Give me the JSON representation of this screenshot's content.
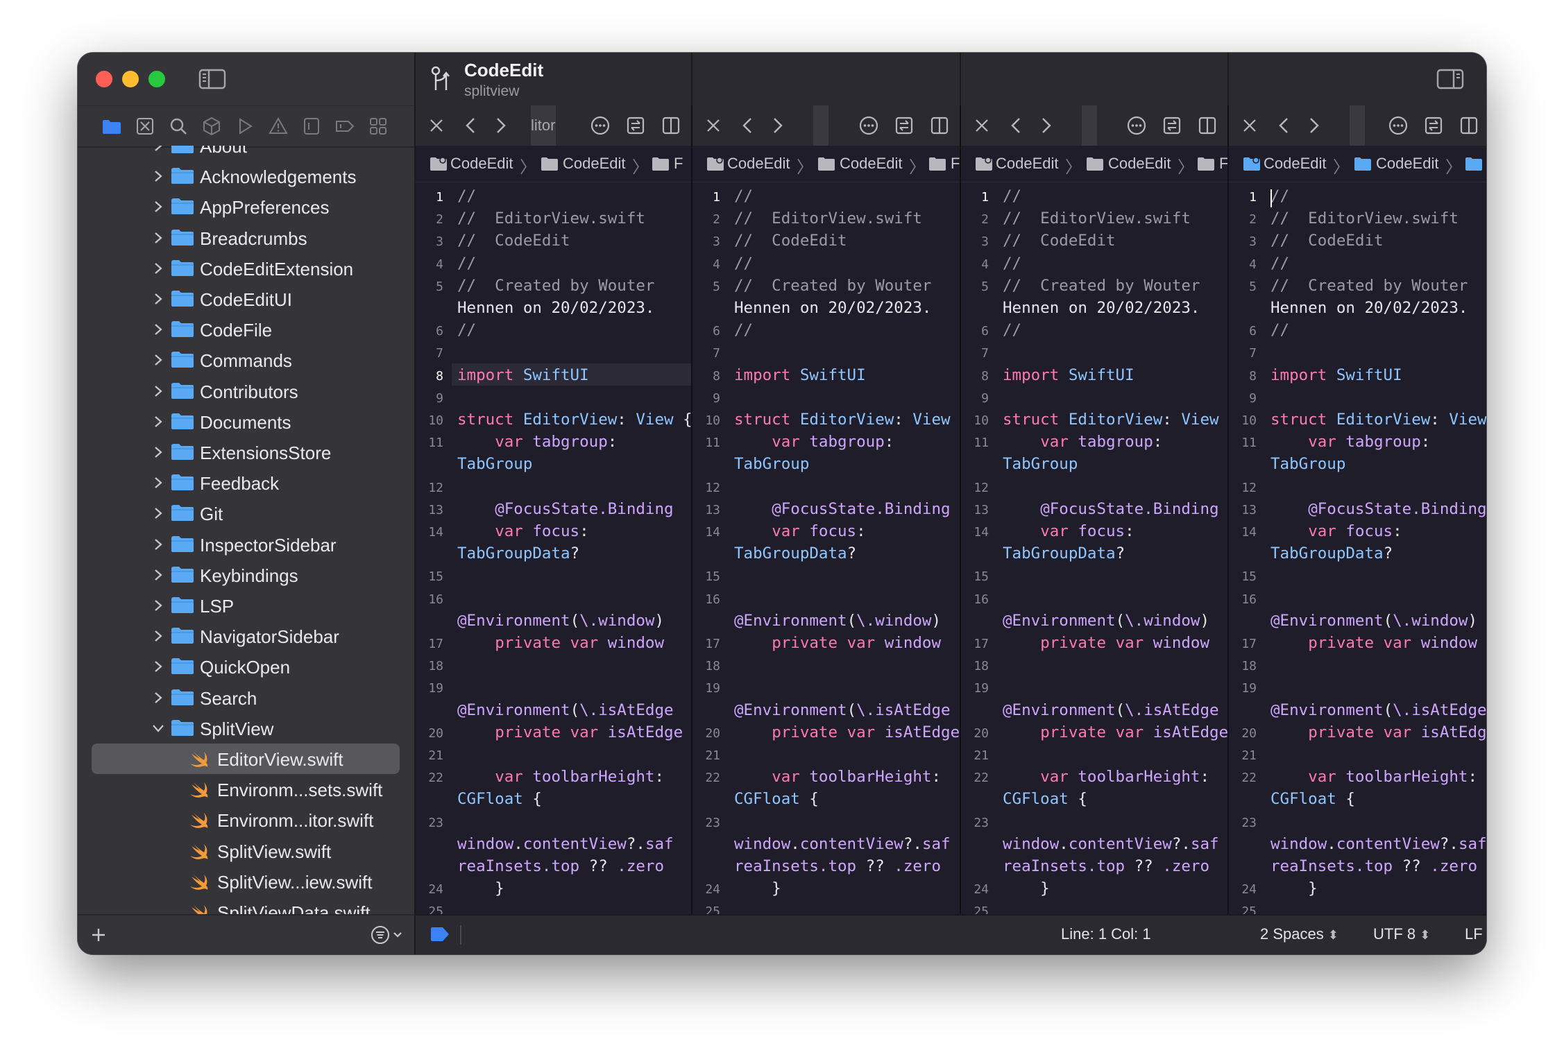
{
  "project": {
    "title": "CodeEdit",
    "subtitle": "splitview"
  },
  "tree": {
    "partial_top": "About",
    "folders": [
      "Acknowledgements",
      "AppPreferences",
      "Breadcrumbs",
      "CodeEditExtension",
      "CodeEditUI",
      "CodeFile",
      "Commands",
      "Contributors",
      "Documents",
      "ExtensionsStore",
      "Feedback",
      "Git",
      "InspectorSidebar",
      "Keybindings",
      "LSP",
      "NavigatorSidebar",
      "QuickOpen",
      "Search"
    ],
    "expanded_folder": "SplitView",
    "files": [
      "EditorView.swift",
      "Environm...sets.swift",
      "Environm...itor.swift",
      "SplitView.swift",
      "SplitView...iew.swift",
      "SplitViewData.swift"
    ],
    "selected_file": "EditorView.swift"
  },
  "panes": [
    {
      "tab_stub": "litor",
      "breadcrumb": [
        "CodeEdit",
        "CodeEdit",
        "F"
      ]
    },
    {
      "tab_stub": "",
      "breadcrumb": [
        "CodeEdit",
        "CodeEdit",
        "F"
      ]
    },
    {
      "tab_stub": "",
      "breadcrumb": [
        "CodeEdit",
        "CodeEdit",
        "F"
      ]
    },
    {
      "tab_stub": "",
      "breadcrumb": [
        "CodeEdit",
        "CodeEdit",
        "F"
      ]
    }
  ],
  "code_lines": [
    {
      "n": "1",
      "t": "//"
    },
    {
      "n": "2",
      "t": "//  EditorView.swift"
    },
    {
      "n": "3",
      "t": "//  CodeEdit"
    },
    {
      "n": "4",
      "t": "//"
    },
    {
      "n": "5",
      "t": "//  Created by Wouter"
    },
    {
      "n": "",
      "t": "Hennen on 20/02/2023."
    },
    {
      "n": "6",
      "t": "//"
    },
    {
      "n": "7",
      "t": ""
    },
    {
      "n": "8",
      "t": "import SwiftUI"
    },
    {
      "n": "9",
      "t": ""
    },
    {
      "n": "10",
      "t": "struct EditorView: View {"
    },
    {
      "n": "11",
      "t": "    var tabgroup:"
    },
    {
      "n": "",
      "t": "TabGroup"
    },
    {
      "n": "12",
      "t": ""
    },
    {
      "n": "13",
      "t": "    @FocusState.Binding"
    },
    {
      "n": "14",
      "t": "    var focus:"
    },
    {
      "n": "",
      "t": "TabGroupData?"
    },
    {
      "n": "15",
      "t": ""
    },
    {
      "n": "16",
      "t": ""
    },
    {
      "n": "",
      "t": "@Environment(\\.window)"
    },
    {
      "n": "17",
      "t": "    private var window"
    },
    {
      "n": "18",
      "t": ""
    },
    {
      "n": "19",
      "t": ""
    },
    {
      "n": "",
      "t": "@Environment(\\.isAtEdge"
    },
    {
      "n": "20",
      "t": "    private var isAtEdge"
    },
    {
      "n": "21",
      "t": ""
    },
    {
      "n": "22",
      "t": "    var toolbarHeight:"
    },
    {
      "n": "",
      "t": "CGFloat {"
    },
    {
      "n": "23",
      "t": ""
    },
    {
      "n": "",
      "t": "window.contentView?.saf"
    },
    {
      "n": "",
      "t": "reaInsets.top ?? .zero"
    },
    {
      "n": "24",
      "t": "    }"
    },
    {
      "n": "25",
      "t": ""
    }
  ],
  "status": {
    "position": "Line: 1  Col: 1",
    "indent": "2 Spaces",
    "encoding": "UTF 8",
    "line_ending": "LF"
  },
  "colors": {
    "accent": "#3b82f6",
    "folder": "#5aa9f5",
    "swift": "#f39a3a",
    "keyword": "#ff7ab2",
    "type": "#8fc6ff",
    "attribute": "#cfa6ff",
    "comment": "#9c9ba1"
  }
}
